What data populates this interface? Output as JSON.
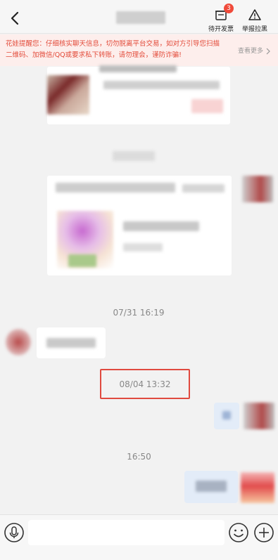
{
  "header": {
    "back_icon": "chevron-left-icon",
    "actions": [
      {
        "label": "待开发票",
        "icon": "invoice-icon",
        "badge": "3"
      },
      {
        "label": "举报拉黑",
        "icon": "warning-triangle-icon"
      }
    ]
  },
  "warning": {
    "text": "花娃提醒您：仔细核实聊天信息，切勿脱离平台交易，如对方引导您扫描二维码、加微信/QQ或要求私下转账，请勿理会，谨防诈骗!",
    "more_label": "查看更多"
  },
  "timestamps": {
    "t1": "07/31 16:19",
    "t2": "08/04 13:32",
    "t3": "16:50"
  },
  "input_bar": {
    "voice_icon": "microphone-icon",
    "emoji_icon": "smiley-icon",
    "plus_icon": "plus-circle-icon"
  },
  "colors": {
    "warning_text": "#e34b3a",
    "warning_bg": "#fdeeec",
    "badge": "#f04a3a",
    "highlight": "#e04a3f",
    "background": "#f2f2f2"
  }
}
